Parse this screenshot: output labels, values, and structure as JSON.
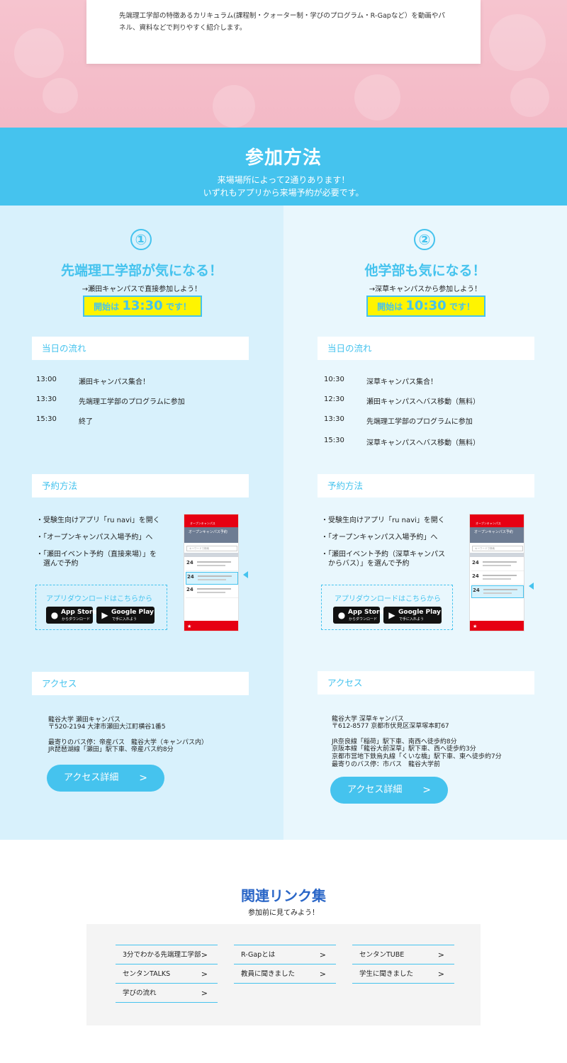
{
  "intro": {
    "text": "先端理工学部の特徴あるカリキュラム(課程制・クォーター制・学びのプログラム・R-Gapなど）を動画やパネル、資料などで判りやすく紹介します。"
  },
  "howto": {
    "title": "参加方法",
    "sub1": "来場場所によって2通りあります！",
    "sub2": "いずれもアプリから来場予約が必要です。"
  },
  "left": {
    "num": "①",
    "title": "先端理工学部が気になる！",
    "route": "→瀬田キャンパスで直接参加しよう！",
    "start_prefix": "開始は",
    "start_time": "13:30",
    "start_suffix": "です！",
    "flow_head": "当日の流れ",
    "flow": [
      {
        "time": "13:00",
        "desc": "瀬田キャンパス集合！"
      },
      {
        "time": "13:30",
        "desc": "先端理工学部のプログラムに参加"
      },
      {
        "time": "15:30",
        "desc": "終了"
      }
    ],
    "reserve_head": "予約方法",
    "reserve": [
      "・受験生向けアプリ「ru navi」を開く",
      "・「オープンキャンパス入場予約」へ",
      "・「瀬田イベント予約（直接来場）」を",
      "　選んで予約"
    ],
    "download_label": "アプリダウンロードはこちらから",
    "access_head": "アクセス",
    "access": [
      "龍谷大学 瀬田キャンパス",
      "〒520-2194 大津市瀬田大江町横谷1番5",
      "",
      "最寄りのバス停：帝産バス　龍谷大学（キャンパス内）",
      "JR琵琶湖線「瀬田」駅下車、帝産バス約8分"
    ],
    "access_btn": "アクセス詳細",
    "access_arrow": ">"
  },
  "right": {
    "num": "②",
    "title": "他学部も気になる！",
    "route": "→深草キャンパスから参加しよう！",
    "start_prefix": "開始は",
    "start_time": "10:30",
    "start_suffix": "です！",
    "flow_head": "当日の流れ",
    "flow": [
      {
        "time": "10:30",
        "desc": "深草キャンパス集合！"
      },
      {
        "time": "12:30",
        "desc": "瀬田キャンパスへバス移動（無料）"
      },
      {
        "time": "13:30",
        "desc": "先端理工学部のプログラムに参加"
      },
      {
        "time": "15:30",
        "desc": "深草キャンパスへバス移動（無料）"
      }
    ],
    "reserve_head": "予約方法",
    "reserve": [
      "・受験生向けアプリ「ru navi」を開く",
      "・「オープンキャンパス入場予約」へ",
      "・「瀬田イベント予約（深草キャンパス",
      "　からバス）」を選んで予約"
    ],
    "download_label": "アプリダウンロードはこちらから",
    "access_head": "アクセス",
    "access": [
      "龍谷大学 深草キャンパス",
      "〒612-8577 京都市伏見区深草塚本町67",
      "",
      "JR奈良線「稲荷」駅下車、南西へ徒歩約8分",
      "京阪本線「龍谷大前深草」駅下車、西へ徒歩約3分",
      "京都市営地下鉄烏丸線「くいな橋」駅下車、東へ徒歩約7分",
      "最寄りのバス停：市バス　龍谷大学前"
    ],
    "access_btn": "アクセス詳細",
    "access_arrow": ">"
  },
  "stores": {
    "apple_main": "App Store",
    "apple_sub": "からダウンロード",
    "google_main": "Google Play",
    "google_sub": "で手に入れよう"
  },
  "phone": {
    "header": "オープンキャンパス",
    "banner": "オープンキャンパス予約",
    "search": "キーワードで検索",
    "date": "24"
  },
  "links": {
    "title": "関連リンク集",
    "sub": "参加前に見てみよう！",
    "arrow": ">",
    "items": [
      "3分でわかる先端理工学部",
      "R-Gapとは",
      "センタンTUBE",
      "センタンTALKS",
      "教員に聞きました",
      "学生に聞きました",
      "学びの流れ"
    ]
  },
  "colors": {
    "accent": "#45c3ee",
    "highlight": "#fff400",
    "link_title": "#2a66c7"
  }
}
